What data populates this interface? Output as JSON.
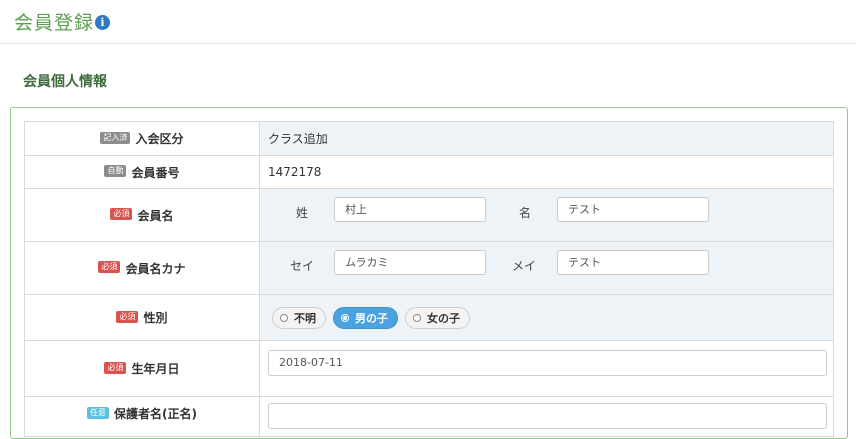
{
  "header": {
    "title": "会員登録",
    "info_icon": "info-circle-icon"
  },
  "section": {
    "title": "会員個人情報"
  },
  "rows": {
    "entry_type": {
      "badge": "記入済",
      "label": "入会区分",
      "value": "クラス追加"
    },
    "member_no": {
      "badge": "自動",
      "label": "会員番号",
      "value": "1472178"
    },
    "member_name": {
      "badge": "必須",
      "label": "会員名",
      "sei_label": "姓",
      "sei_value": "村上",
      "mei_label": "名",
      "mei_value": "テスト"
    },
    "member_kana": {
      "badge": "必須",
      "label": "会員名カナ",
      "sei_label": "セイ",
      "sei_value": "ムラカミ",
      "mei_label": "メイ",
      "mei_value": "テスト"
    },
    "gender": {
      "badge": "必須",
      "label": "性別",
      "options": [
        "不明",
        "男の子",
        "女の子"
      ],
      "selected": "男の子"
    },
    "birthdate": {
      "badge": "必須",
      "label": "生年月日",
      "value": "2018-07-11"
    },
    "guardian": {
      "badge": "任意",
      "label": "保護者名(正名)"
    }
  },
  "colors": {
    "title": "#5c9e52",
    "panel_border": "#8fc98a",
    "badge_required": "#d9534f",
    "badge_auto": "#8c8c8c",
    "selected": "#4aa3df"
  }
}
